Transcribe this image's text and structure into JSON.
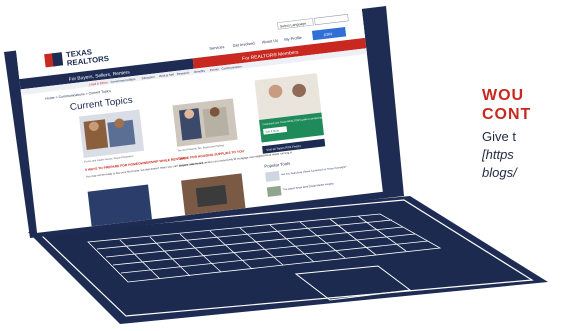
{
  "site": {
    "logo_top": "TEXAS",
    "logo_bottom": "REALTORS",
    "utility_select": "Select Language",
    "nav": [
      "Services",
      "Get Involved",
      "About Us",
      "My Profile"
    ],
    "nav_button": "JOIN",
    "bar_left": "For Buyers, Sellers, Renters",
    "bar_right": "For REALTOR® Members",
    "sub_nav": [
      "Legal & Ethics",
      "Government Affairs",
      "Education",
      "Rent & Sell",
      "Research",
      "Benefits",
      "Events",
      "Communication"
    ],
    "breadcrumb": "Home  >  Communications  >  Current Topics",
    "page_title": "Current Topics",
    "cards": [
      {
        "caption": "Forms and Health Issues, Record Retention",
        "title": "5 WAYS TO PREPARE FOR HOMEOWNERSHIP WHILE RENTING",
        "text": "You may not be ready to buy your first home, but that doesn't mean you can't prepare now. Here's"
      },
      {
        "caption": "Tax and Property Tax, Buying and Selling",
        "title": "GUIDE FOR HOUSING SUPPLIES TO YOU",
        "text": "Buyers, sellers, and renters can productively fill mortgage and neighborhood needs running to"
      }
    ],
    "side_promo": "Download your Texas REALTORS guide to preparing for homeownership while renting",
    "side_button": "Get it Now",
    "side_link": "Visit all Topics RSS Feed ▸",
    "popular_title": "Popular Tools",
    "popular_items": [
      "Are You Searching (Texas Correction) or Texas Oversight?",
      "The Latest Texas Real Estate Market Insights"
    ]
  },
  "promo": {
    "line1": "WOU",
    "line2": "CONT",
    "body": "Give t",
    "link1": "[https",
    "link2": "blogs/"
  },
  "colors": {
    "navy": "#1e2c54",
    "red": "#c8281f",
    "laptop_outline": "#1e2c54"
  }
}
